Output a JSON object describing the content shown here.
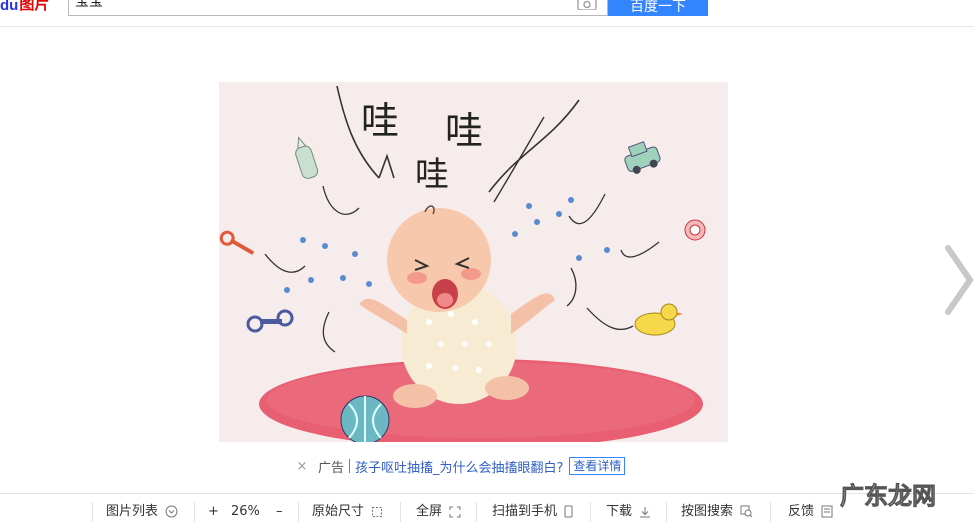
{
  "header": {
    "logo_du": "du",
    "logo_text": "图片",
    "search_value": "宝宝",
    "search_button": "百度一下"
  },
  "image": {
    "text_1": "哇",
    "text_2": "哇",
    "text_3": "哇"
  },
  "ad": {
    "close": "×",
    "tag": "广告",
    "link": "孩子呕吐抽搐_为什么会抽搐眼翻白?",
    "detail": "查看详情"
  },
  "toolbar": {
    "list": "图片列表",
    "zoom_in": "+",
    "zoom": "26%",
    "zoom_out": "–",
    "original": "原始尺寸",
    "fullscreen": "全屏",
    "scan": "扫描到手机",
    "download": "下载",
    "search_by_image": "按图搜索",
    "feedback": "反馈"
  },
  "watermark": {
    "text": "广东龙网"
  },
  "colors": {
    "search_button": "#3385ff",
    "logo_red": "#e10601",
    "logo_blue": "#2932e1",
    "link": "#3060c8"
  }
}
